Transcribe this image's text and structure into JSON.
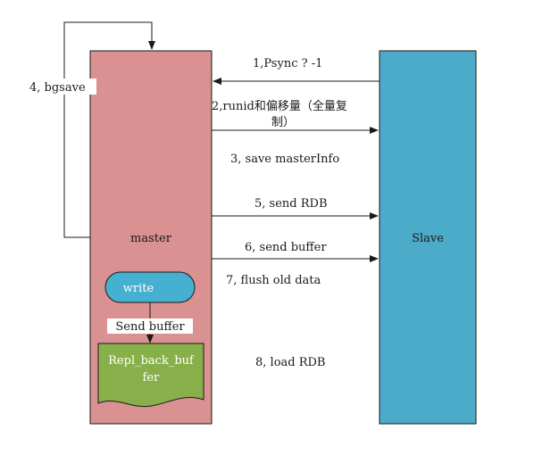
{
  "colors": {
    "master_fill": "#da9191",
    "slave_fill": "#4cabc9",
    "write_fill": "#45b0cf",
    "buffer_fill": "#88b04a",
    "line": "#1a1a1a"
  },
  "master": {
    "label": "master"
  },
  "slave": {
    "label": "Slave"
  },
  "write_node": {
    "label": "write"
  },
  "send_buffer_label": "Send buffer",
  "buffer_node": {
    "line1": "Repl_back_buf",
    "line2": "fer"
  },
  "bgsave_label": "4, bgsave",
  "steps": [
    {
      "line1": "1,Psync ? -1"
    },
    {
      "line1": "2,runid和偏移量（全量复",
      "line2": "制）"
    },
    {
      "line1": "3, save masterInfo"
    },
    {
      "line1": "5, send RDB"
    },
    {
      "line1": "6, send buffer"
    },
    {
      "line1": "7, flush old data"
    },
    {
      "line1": "8, load RDB"
    }
  ]
}
